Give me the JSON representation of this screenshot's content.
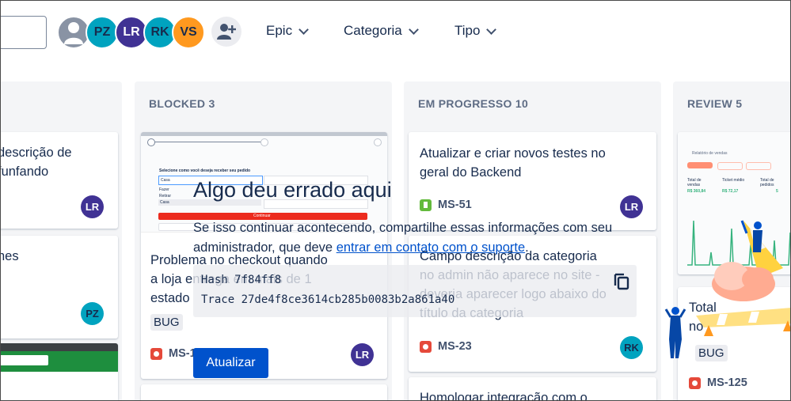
{
  "toolbar": {
    "search": {
      "placeholder": ""
    },
    "avatars": [
      {
        "initials": "PZ",
        "color": "#00a3bf"
      },
      {
        "initials": "LR",
        "color": "#403294"
      },
      {
        "initials": "RK",
        "color": "#00a3bf"
      },
      {
        "initials": "VS",
        "color": "#ff991f"
      }
    ],
    "filters": [
      {
        "label": "Epic"
      },
      {
        "label": "Categoria"
      },
      {
        "label": "Tipo"
      }
    ]
  },
  "columns": [
    {
      "title": "",
      "cards": [
        {
          "title": "descrição de\nfunfando",
          "assignee": "LR",
          "assignee_color": "#403294"
        },
        {
          "title": "nes",
          "assignee": "PZ",
          "assignee_color": "#00a3bf"
        }
      ]
    },
    {
      "title": "BLOCKED 3",
      "cards": [
        {
          "preview": {
            "heading": "Selecione como você deseja receber seu pedido",
            "options": [
              "Casa",
              "Fazer",
              "Retirar",
              "Casa"
            ],
            "button": "Continuar"
          },
          "title": "Problema no checkout quando\na loja entrega em mais de 1\nestado",
          "tag": "BUG",
          "issue": "MS-1",
          "assignee": "LR",
          "assignee_color": "#403294"
        }
      ]
    },
    {
      "title": "EM PROGRESSO 10",
      "cards": [
        {
          "title": "Atualizar e criar novos testes no\ngeral do Backend",
          "issue": "MS-51",
          "assignee": "LR",
          "assignee_color": "#403294"
        },
        {
          "title": "Campo descrição da categoria\nno admin não aparece no site -\ndeveria aparecer logo abaixo do\ntítulo da categoria",
          "issue": "MS-23",
          "assignee": "RK",
          "assignee_color": "#00a3bf"
        },
        {
          "title": "Homologar integração com o"
        }
      ]
    },
    {
      "title": "REVIEW 5",
      "cards": [
        {
          "preview": {
            "heading": "Relatório de vendas",
            "stats": [
              {
                "label": "Total de vendas",
                "value": "R$ 360,84"
              },
              {
                "label": "Ticket médio",
                "value": "R$ 72,17"
              },
              {
                "label": "Total de pedidos",
                "value": "5"
              }
            ]
          },
          "title": "Total\nno",
          "tag": "BUG",
          "issue": "MS-125"
        }
      ]
    }
  ],
  "error": {
    "title": "Algo deu errado aqui",
    "message_before": "Se isso continuar acontecendo, compartilhe essas informações com seu administrador, que deve ",
    "link": "entrar em contato com o suporte",
    "message_after": ".",
    "hash": "Hash 7f84ff8",
    "trace": "Trace 27de4f8ce3614cb285b0083b2a861a40",
    "refresh_label": "Atualizar"
  }
}
